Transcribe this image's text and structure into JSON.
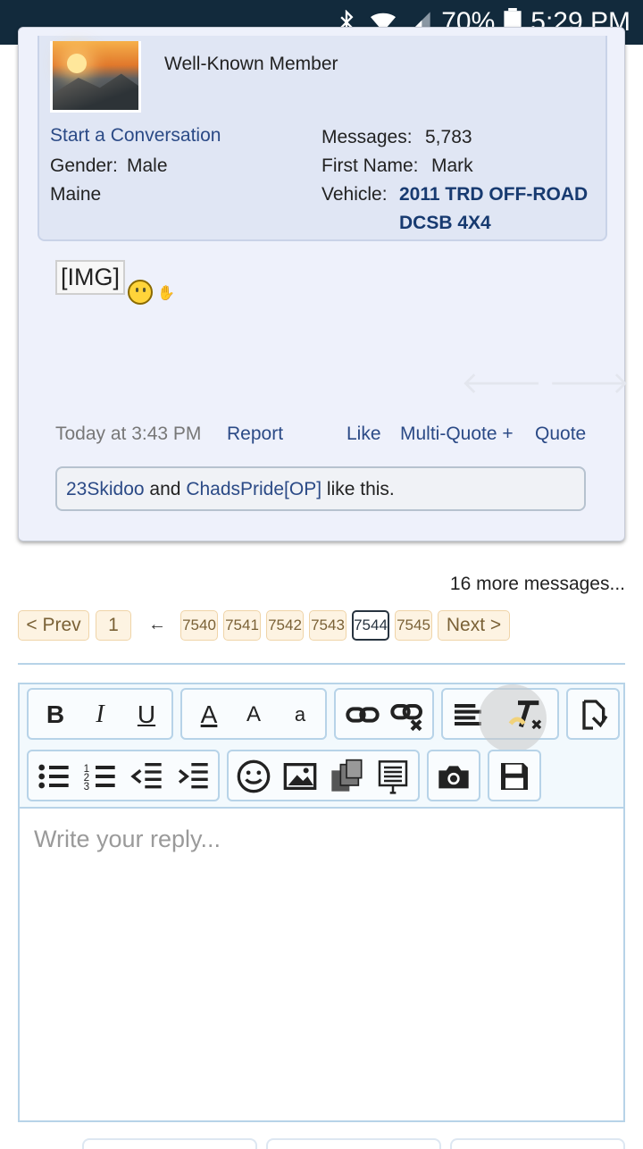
{
  "status_bar": {
    "battery": "70%",
    "time": "5:29 PM"
  },
  "member": {
    "role": "Well-Known Member",
    "start_conversation": "Start a Conversation",
    "gender_label": "Gender:",
    "gender_value": "Male",
    "location": "Maine",
    "messages_label": "Messages:",
    "messages_value": "5,783",
    "first_name_label": "First Name:",
    "first_name_value": "Mark",
    "vehicle_label": "Vehicle:",
    "vehicle_line1": "2011 TRD OFF-ROAD",
    "vehicle_line2": "DCSB 4X4"
  },
  "post": {
    "img_tag": "[IMG]",
    "timestamp": "Today at 3:43 PM",
    "report": "Report",
    "like": "Like",
    "multi_quote": "Multi-Quote +",
    "quote": "Quote",
    "likes": {
      "user1": "23Skidoo",
      "and": "and",
      "user2": "ChadsPride",
      "op": "[OP]",
      "suffix": "like this."
    }
  },
  "more_messages": "16 more messages...",
  "pagination": {
    "prev": "< Prev",
    "first": "1",
    "arrow": "←",
    "pages": [
      "7540",
      "7541",
      "7542",
      "7543",
      "7544",
      "7545"
    ],
    "current": "7544",
    "next": "Next >"
  },
  "editor": {
    "placeholder": "Write your reply...",
    "tools": {
      "bold": "B",
      "italic": "I",
      "underline": "U",
      "font_color": "A",
      "font_size": "A",
      "font_family": "a"
    }
  },
  "icons": [
    "bluetooth-icon",
    "wifi-icon",
    "signal-icon",
    "battery-icon",
    "arrow-left-icon",
    "arrow-right-icon",
    "smiley-icon"
  ]
}
